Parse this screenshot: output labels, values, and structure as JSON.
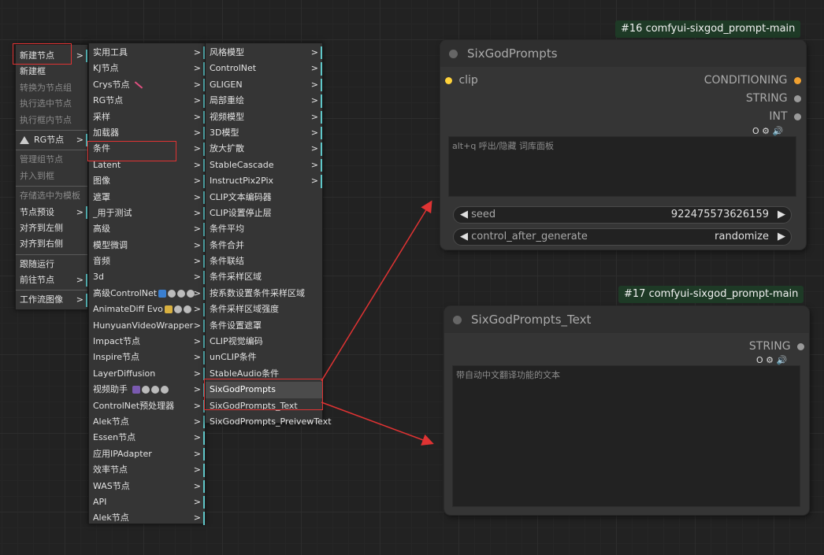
{
  "menu1": {
    "items": [
      {
        "label": "新建节点",
        "arrow": ">",
        "disabled": false
      },
      {
        "label": "新建框",
        "arrow": "",
        "disabled": false
      },
      {
        "label": "转换为节点组",
        "arrow": "",
        "disabled": true
      },
      {
        "label": "执行选中节点",
        "arrow": "",
        "disabled": true
      },
      {
        "label": "执行框内节点",
        "arrow": "",
        "disabled": true
      },
      {
        "label": "RG节点",
        "arrow": ">",
        "disabled": false
      },
      {
        "label": "管理组节点",
        "arrow": "",
        "disabled": true
      },
      {
        "label": "并入到框",
        "arrow": "",
        "disabled": true
      },
      {
        "label": "存储选中为模板",
        "arrow": "",
        "disabled": true
      },
      {
        "label": "节点预设",
        "arrow": ">",
        "disabled": false
      },
      {
        "label": "对齐到左侧",
        "arrow": "",
        "disabled": false
      },
      {
        "label": "对齐到右侧",
        "arrow": "",
        "disabled": false
      },
      {
        "label": "跟随运行",
        "arrow": "",
        "disabled": false
      },
      {
        "label": "前往节点",
        "arrow": ">",
        "disabled": false
      },
      {
        "label": "工作流图像",
        "arrow": ">",
        "disabled": false
      }
    ]
  },
  "menu2": {
    "items": [
      "实用工具",
      "KJ节点",
      "Crys节点",
      "RG节点",
      "采样",
      "加载器",
      "条件",
      "Latent",
      "图像",
      "遮罩",
      "_用于测试",
      "高级",
      "模型微调",
      "音频",
      "3d",
      "高级ControlNet",
      "AnimateDiff Evo",
      "HunyuanVideoWrapper",
      "Impact节点",
      "Inspire节点",
      "LayerDiffusion",
      "视频助手",
      "ControlNet预处理器",
      "Alek节点",
      "Essen节点",
      "应用IPAdapter",
      "效率节点",
      "WAS节点",
      "API",
      "Alek节点"
    ],
    "arrow": ">"
  },
  "menu3": {
    "items": [
      {
        "label": "风格模型",
        "sub": true
      },
      {
        "label": "ControlNet",
        "sub": true
      },
      {
        "label": "GLIGEN",
        "sub": true
      },
      {
        "label": "局部重绘",
        "sub": true
      },
      {
        "label": "视频模型",
        "sub": true
      },
      {
        "label": "3D模型",
        "sub": true
      },
      {
        "label": "放大扩散",
        "sub": true
      },
      {
        "label": "StableCascade",
        "sub": true
      },
      {
        "label": "InstructPix2Pix",
        "sub": true
      },
      {
        "label": "CLIP文本编码器",
        "sub": false
      },
      {
        "label": "CLIP设置停止层",
        "sub": false
      },
      {
        "label": "条件平均",
        "sub": false
      },
      {
        "label": "条件合并",
        "sub": false
      },
      {
        "label": "条件联结",
        "sub": false
      },
      {
        "label": "条件采样区域",
        "sub": false
      },
      {
        "label": "按系数设置条件采样区域",
        "sub": false
      },
      {
        "label": "条件采样区域强度",
        "sub": false
      },
      {
        "label": "条件设置遮罩",
        "sub": false
      },
      {
        "label": "CLIP视觉编码",
        "sub": false
      },
      {
        "label": "unCLIP条件",
        "sub": false
      },
      {
        "label": "StableAudio条件",
        "sub": false
      },
      {
        "label": "SixGodPrompts",
        "sub": false
      },
      {
        "label": "SixGodPrompts_Text",
        "sub": false
      },
      {
        "label": "SixGodPrompts_PreivewText",
        "sub": false
      }
    ],
    "arrow": ">"
  },
  "node16": {
    "tag": "#16 comfyui-sixgod_prompt-main",
    "title": "SixGodPrompts",
    "input": "clip",
    "outputs": [
      "CONDITIONING",
      "STRING",
      "INT"
    ],
    "icons": "O ⚙ 🔊",
    "textarea": "alt+q 呼出/隐藏 词库面板",
    "widgets": [
      {
        "label": "seed",
        "value": "922475573626159"
      },
      {
        "label": "control_after_generate",
        "value": "randomize"
      }
    ]
  },
  "node17": {
    "tag": "#17 comfyui-sixgod_prompt-main",
    "title": "SixGodPrompts_Text",
    "outputs": [
      "STRING"
    ],
    "icons": "O ⚙ 🔊",
    "textarea": "带自动中文翻译功能的文本"
  },
  "colors": {
    "accent_cyan": "#5fc6c8",
    "highlight_red": "#e03333",
    "tag_green": "#1e3a26",
    "clip_slot": "#ffd23a",
    "conditioning_slot": "#f0a030"
  }
}
